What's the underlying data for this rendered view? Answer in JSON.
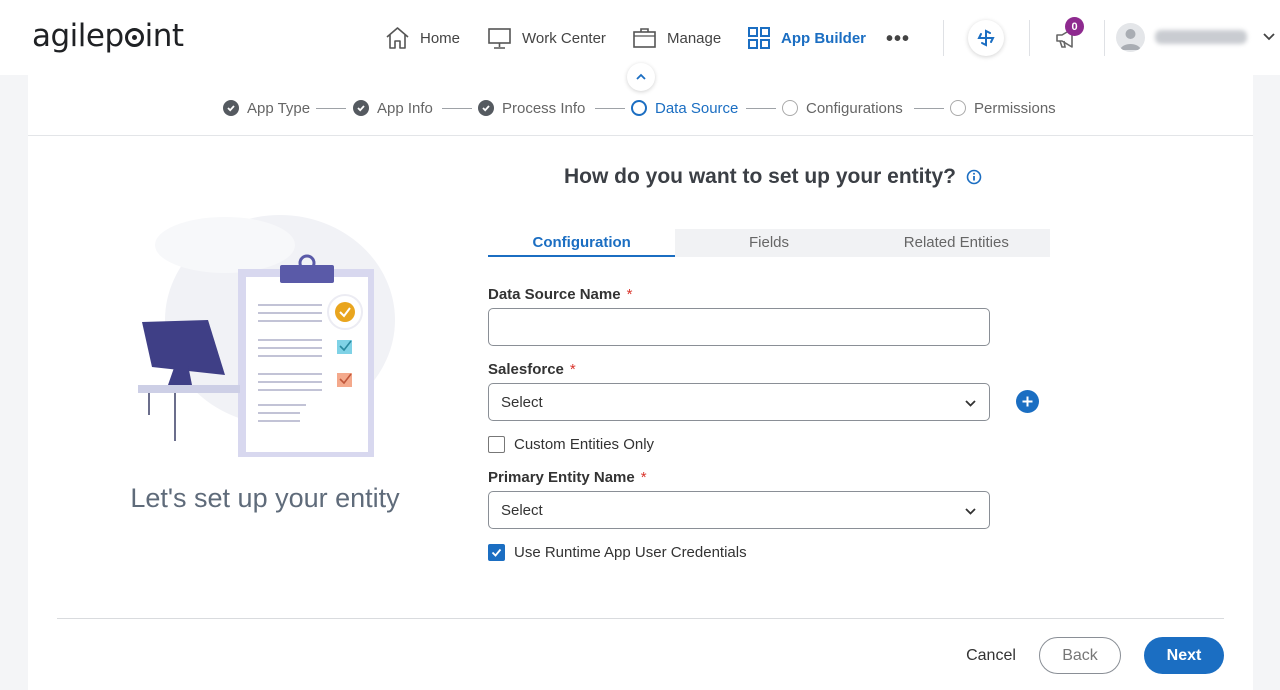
{
  "header": {
    "logo": {
      "pre": "agilep",
      "post": "int"
    },
    "nav": [
      {
        "label": "Home",
        "icon": "home-icon"
      },
      {
        "label": "Work Center",
        "icon": "monitor-icon"
      },
      {
        "label": "Manage",
        "icon": "briefcase-icon"
      },
      {
        "label": "App Builder",
        "icon": "grid-icon",
        "active": true
      }
    ],
    "more": "•••",
    "notifications_count": "0",
    "accent_color": "#1b6ec2",
    "badge_color": "#8e2a8f"
  },
  "steps": [
    {
      "label": "App Type",
      "status": "done"
    },
    {
      "label": "App Info",
      "status": "done"
    },
    {
      "label": "Process Info",
      "status": "done"
    },
    {
      "label": "Data Source",
      "status": "current"
    },
    {
      "label": "Configurations",
      "status": "todo"
    },
    {
      "label": "Permissions",
      "status": "todo"
    }
  ],
  "illustration": {
    "caption": "Let's set up your entity"
  },
  "form": {
    "title": "How do you want to set up your entity?",
    "tabs": [
      "Configuration",
      "Fields",
      "Related Entities"
    ],
    "active_tab": "Configuration",
    "data_source_name": {
      "label": "Data Source Name",
      "required": "*",
      "value": ""
    },
    "salesforce": {
      "label": "Salesforce",
      "required": "*",
      "value": "Select"
    },
    "custom_entities_only": {
      "label": "Custom Entities Only",
      "checked": false
    },
    "primary_entity_name": {
      "label": "Primary Entity Name",
      "required": "*",
      "value": "Select"
    },
    "use_runtime_credentials": {
      "label": "Use Runtime App User Credentials",
      "checked": true
    }
  },
  "footer": {
    "cancel": "Cancel",
    "back": "Back",
    "next": "Next"
  }
}
